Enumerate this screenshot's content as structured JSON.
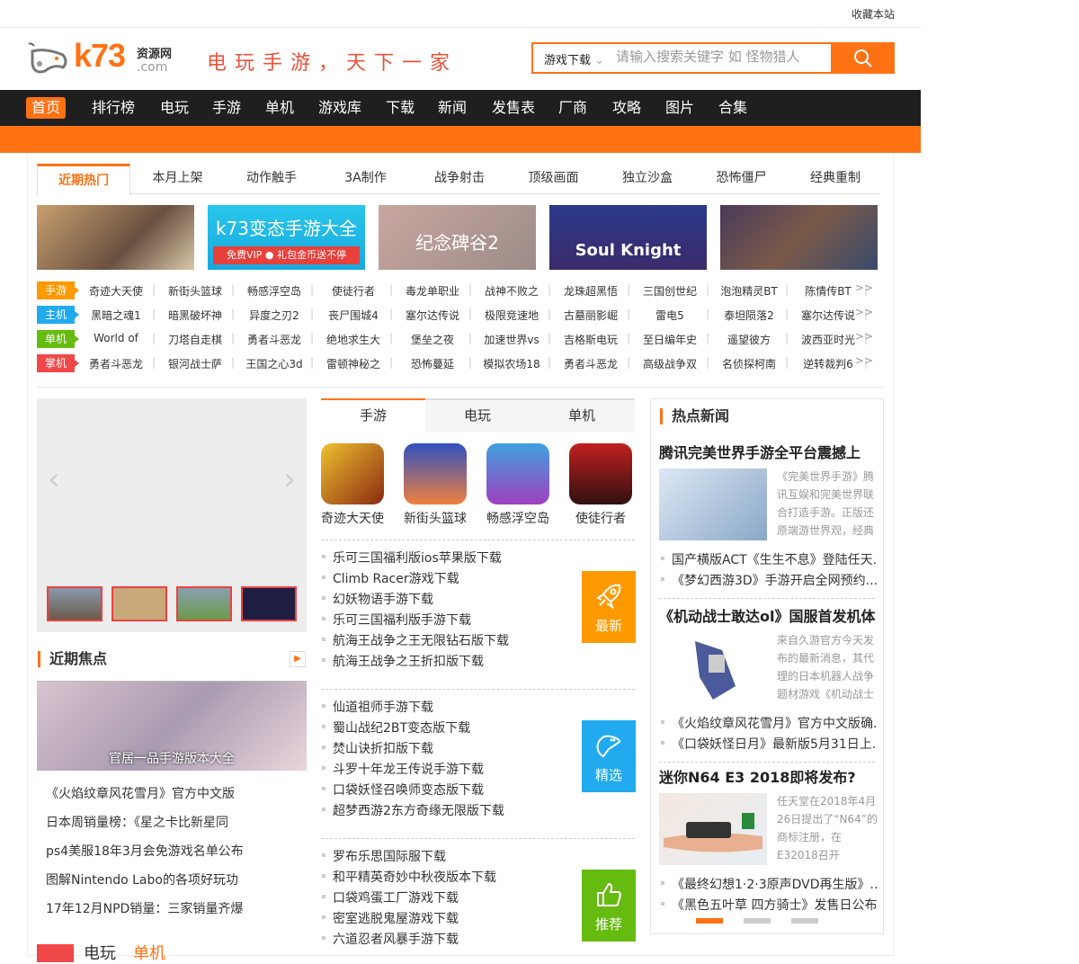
{
  "topbar": {
    "favorite": "收藏本站"
  },
  "logo": {
    "brand": "k73",
    "cn": "资源网",
    "com": ".com"
  },
  "slogan": "电玩手游，天下一家",
  "search": {
    "category": "游戏下载",
    "placeholder": "请输入搜索关键字 如 怪物猎人"
  },
  "nav": [
    "首页",
    "排行榜",
    "电玩",
    "手游",
    "单机",
    "游戏库",
    "下载",
    "新闻",
    "发售表",
    "厂商",
    "攻略",
    "图片",
    "合集"
  ],
  "cat_tabs": [
    "近期热门",
    "本月上架",
    "动作触手",
    "3A制作",
    "战争射击",
    "顶级画面",
    "独立沙盒",
    "恐怖僵尸",
    "经典重制"
  ],
  "banners": [
    {
      "t1": "",
      "t2": ""
    },
    {
      "t1": "k73变态手游大全",
      "t2": "免费VIP ● 礼包金币送不停"
    },
    {
      "t1": "纪念碑谷2",
      "t2": ""
    },
    {
      "t1": "Soul Knight",
      "t2": ""
    },
    {
      "t1": "",
      "t2": ""
    }
  ],
  "rows": [
    {
      "label": "手游",
      "color": "#ff9900",
      "items": [
        "奇迹大天使",
        "新街头篮球",
        "畅感浮空岛",
        "使徒行者",
        "毒龙单职业",
        "战神不败之",
        "龙珠超黑悟",
        "三国创世纪",
        "泡泡精灵BT",
        "陈情传BT"
      ]
    },
    {
      "label": "主机",
      "color": "#22aaee",
      "items": [
        "黑暗之魂1",
        "暗黑破坏神",
        "异度之刃2",
        "丧尸围城4",
        "塞尔达传说",
        "极限竞速地",
        "古墓丽影崛",
        "雷电5",
        "泰坦陨落2",
        "塞尔达传说"
      ]
    },
    {
      "label": "单机",
      "color": "#66bb11",
      "items": [
        "World of",
        "刀塔自走棋",
        "勇者斗恶龙",
        "绝地求生大",
        "堡垒之夜",
        "加速世界vs",
        "吉格斯电玩",
        "至日编年史",
        "遥望彼方",
        "波西亚时光"
      ]
    },
    {
      "label": "掌机",
      "color": "#f04848",
      "items": [
        "勇者斗恶龙",
        "银河战士萨",
        "王国之心3d",
        "雷顿神秘之",
        "恐怖蔓延",
        "模拟农场18",
        "勇者斗恶龙",
        "高级战争双",
        "名侦探柯南",
        "逆转裁判6"
      ]
    }
  ],
  "more": ">>",
  "focus": {
    "title": "近期焦点",
    "caption": "官居一品手游版本大全",
    "list": [
      "《火焰纹章风花雪月》官方中文版",
      "日本周销量榜：《星之卡比新星同",
      "ps4美服18年3月会免游戏名单公布",
      "图解Nintendo Labo的各项好玩功",
      "17年12月NPD销量：三家销量齐爆"
    ]
  },
  "bottom": {
    "a": "电玩",
    "b": "单机"
  },
  "mid": {
    "tabs": [
      "手游",
      "电玩",
      "单机"
    ],
    "apps": [
      "奇迹大天使",
      "新街头篮球",
      "畅感浮空岛",
      "使徒行者"
    ],
    "groups": [
      {
        "badge": "最新",
        "color": "#ff9900",
        "items": [
          "乐可三国福利版ios苹果版下载",
          "Climb Racer游戏下载",
          "幻妖物语手游下载",
          "乐可三国福利版手游下载",
          "航海王战争之王无限钻石版下载",
          "航海王战争之王折扣版下载"
        ]
      },
      {
        "badge": "精选",
        "color": "#22aaee",
        "items": [
          "仙道祖师手游下载",
          "蜀山战纪2BT变态版下载",
          "焚山诀折扣版下载",
          "斗罗十年龙王传说手游下载",
          "口袋妖怪召唤师变态版下载",
          "超梦西游2东方奇缘无限版下载"
        ]
      },
      {
        "badge": "推荐",
        "color": "#66bb11",
        "items": [
          "罗布乐思国际服下载",
          "和平精英奇妙中秋夜版本下载",
          "口袋鸡蛋工厂游戏下载",
          "密室逃脱鬼屋游戏下载",
          "六道忍者风暴手游下载"
        ]
      }
    ]
  },
  "news": {
    "title": "热点新闻",
    "blocks": [
      {
        "h": "腾讯完美世界手游全平台震撼上",
        "d": "《完美世界手游》腾讯互娱和完美世界联合打造手游。正版还原端游世界观，经典",
        "list": [
          "国产横版ACT《生生不息》登陆任天...",
          "《梦幻西游3D》手游开启全网预约..."
        ]
      },
      {
        "h": "《机动战士敢达ol》国服首发机体",
        "d": "来自久游官方今天发布的最新消息，其代理的日本机器人战争题材游戏《机动战士",
        "list": [
          "《火焰纹章风花雪月》官方中文版确...",
          "《口袋妖怪日月》最新版5月31日上..."
        ]
      },
      {
        "h": "迷你N64 E3 2018即将发布?",
        "d": "任天堂在2018年4月26日提出了“N64”的商标注册，在E32018召开",
        "list": [
          "《最终幻想1·2·3原声DVD再生版》...",
          "《黑色五叶草 四方骑士》发售日公布"
        ]
      }
    ]
  }
}
